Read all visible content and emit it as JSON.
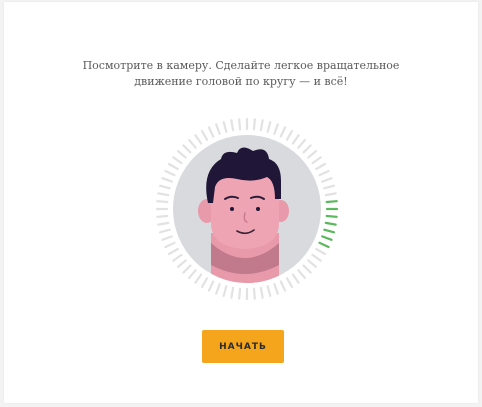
{
  "instruction": {
    "line1": "Посмотрите в камеру. Сделайте легкое вращательное",
    "line2": "движение головой по кругу — и всё!"
  },
  "progress_ring": {
    "completed_fraction": 0.1
  },
  "actions": {
    "start_label": "НАЧАТЬ"
  },
  "colors": {
    "accent": "#f4a51c",
    "tick_done": "#5cb85c",
    "tick_pending": "#e2e2e2",
    "face_bg": "#d9dade"
  },
  "icons": {
    "avatar": "face-illustration"
  }
}
